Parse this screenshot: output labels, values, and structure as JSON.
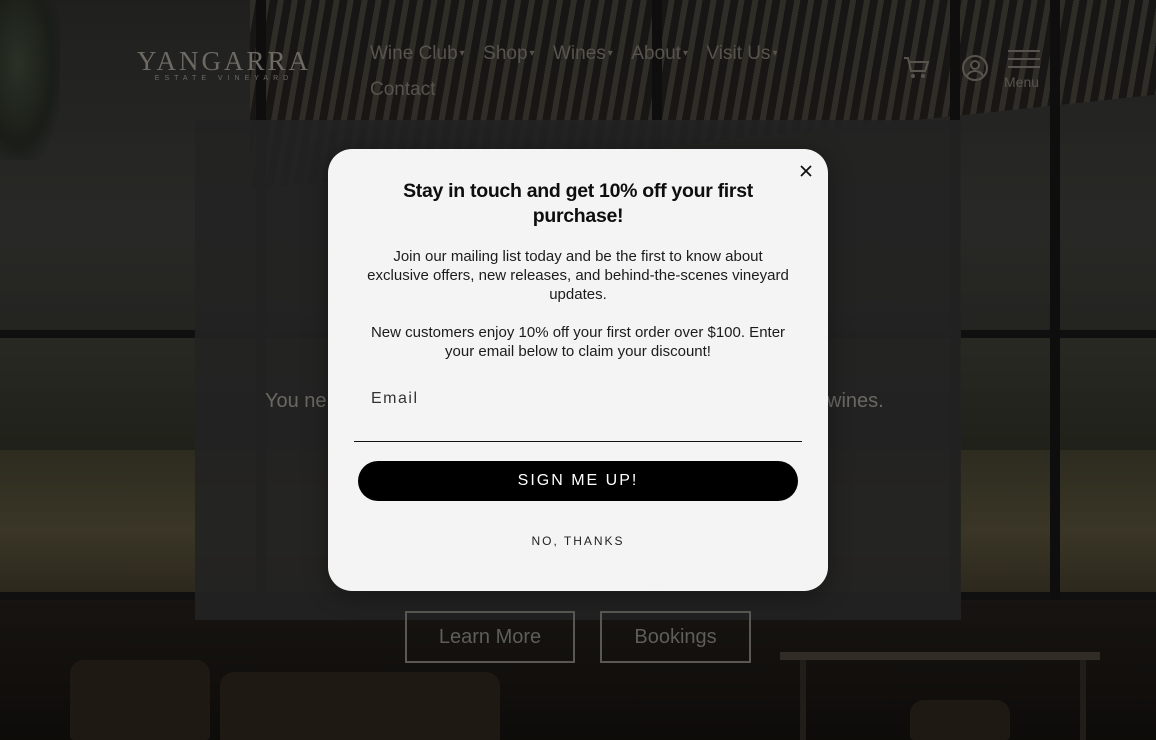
{
  "brand": {
    "name": "YANGARRA",
    "tagline": "ESTATE VINEYARD"
  },
  "nav": {
    "items": [
      {
        "label": "Wine Club",
        "has_dropdown": true
      },
      {
        "label": "Shop",
        "has_dropdown": true
      },
      {
        "label": "Wines",
        "has_dropdown": true
      },
      {
        "label": "About",
        "has_dropdown": true
      },
      {
        "label": "Visit Us",
        "has_dropdown": true
      },
      {
        "label": "Contact",
        "has_dropdown": false
      }
    ],
    "menu_label": "Menu",
    "icons": [
      "cart-icon",
      "account-icon",
      "hamburger-icon"
    ]
  },
  "hero": {
    "text_left": "You ne",
    "text_right": "wines.",
    "buttons": [
      "Learn More",
      "Bookings"
    ]
  },
  "modal": {
    "title": "Stay in touch and get 10% off your first purchase!",
    "body_1": "Join our mailing list today and be the first to know about exclusive offers, new releases, and behind-the-scenes vineyard updates.",
    "body_2": "New customers enjoy 10% off your first order over $100. Enter your email below to claim your discount!",
    "email_placeholder": "Email",
    "email_value": "",
    "submit_label": "SIGN ME UP!",
    "decline_label": "NO, THANKS",
    "close_icon": "close-icon"
  },
  "colors": {
    "modal_bg": "#f4f4f4",
    "submit_bg": "#000000",
    "submit_text": "#ffffff",
    "overlay": "rgba(0,0,0,0.45)"
  }
}
